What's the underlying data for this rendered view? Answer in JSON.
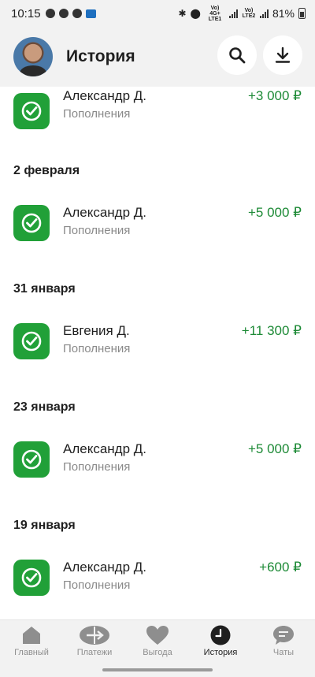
{
  "status": {
    "time": "10:15",
    "battery": "81%",
    "network1": "Vo) 4G+ LTE1",
    "network2": "Vo) LTE2"
  },
  "header": {
    "title": "История",
    "search_icon": "search-icon",
    "download_icon": "download-icon"
  },
  "history": {
    "first": {
      "name": "Александр Д.",
      "category": "Пополнения",
      "amount": "+3 000 ₽"
    },
    "groups": [
      {
        "date": "2 февраля",
        "name": "Александр Д.",
        "category": "Пополнения",
        "amount": "+5 000 ₽"
      },
      {
        "date": "31 января",
        "name": "Евгения Д.",
        "category": "Пополнения",
        "amount": "+11 300 ₽"
      },
      {
        "date": "23 января",
        "name": "Александр Д.",
        "category": "Пополнения",
        "amount": "+5 000 ₽"
      },
      {
        "date": "19 января",
        "name": "Александр Д.",
        "category": "Пополнения",
        "amount": "+600 ₽"
      }
    ]
  },
  "nav": {
    "items": [
      {
        "label": "Главный",
        "icon": "home-icon"
      },
      {
        "label": "Платежи",
        "icon": "transfer-icon"
      },
      {
        "label": "Выгода",
        "icon": "heart-icon"
      },
      {
        "label": "История",
        "icon": "clock-icon"
      },
      {
        "label": "Чаты",
        "icon": "chat-icon"
      }
    ],
    "active": "История"
  },
  "colors": {
    "accent_green": "#21a038",
    "amount_green": "#1d8a36",
    "background": "#f2f2f2"
  }
}
